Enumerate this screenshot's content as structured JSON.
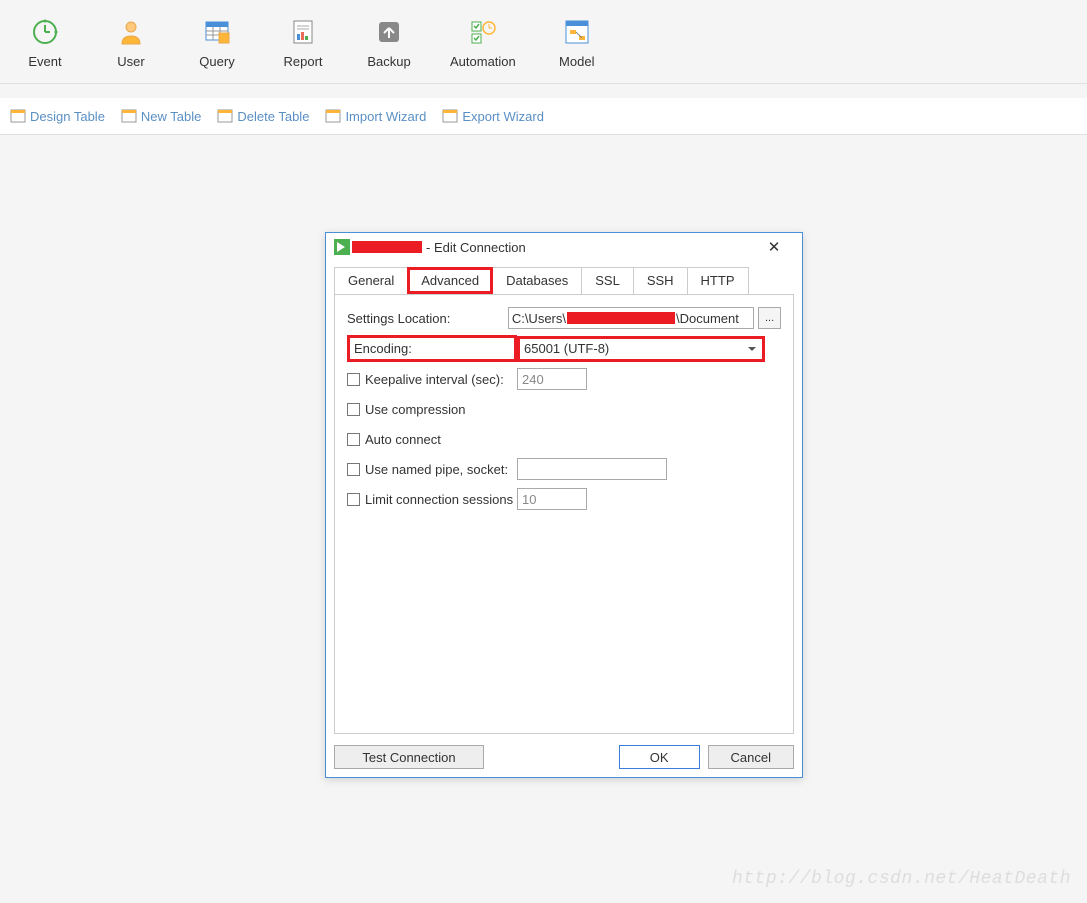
{
  "toolbar": {
    "items": [
      {
        "label": "Event"
      },
      {
        "label": "User"
      },
      {
        "label": "Query"
      },
      {
        "label": "Report"
      },
      {
        "label": "Backup"
      },
      {
        "label": "Automation"
      },
      {
        "label": "Model"
      }
    ]
  },
  "subtoolbar": {
    "items": [
      {
        "label": "Design Table"
      },
      {
        "label": "New Table"
      },
      {
        "label": "Delete Table"
      },
      {
        "label": "Import Wizard"
      },
      {
        "label": "Export Wizard"
      }
    ]
  },
  "dialog": {
    "title_suffix": "- Edit Connection",
    "tabs": [
      {
        "label": "General"
      },
      {
        "label": "Advanced"
      },
      {
        "label": "Databases"
      },
      {
        "label": "SSL"
      },
      {
        "label": "SSH"
      },
      {
        "label": "HTTP"
      }
    ],
    "active_tab_index": 1,
    "form": {
      "settings_location_label": "Settings Location:",
      "settings_location_prefix": "C:\\Users\\",
      "settings_location_suffix": "\\Document",
      "browse_label": "...",
      "encoding_label": "Encoding:",
      "encoding_value": "65001 (UTF-8)",
      "keepalive_label": "Keepalive interval (sec):",
      "keepalive_value": "240",
      "use_compression_label": "Use compression",
      "auto_connect_label": "Auto connect",
      "named_pipe_label": "Use named pipe, socket:",
      "named_pipe_value": "",
      "limit_sessions_label": "Limit connection sessions",
      "limit_sessions_value": "10"
    },
    "buttons": {
      "test": "Test Connection",
      "ok": "OK",
      "cancel": "Cancel"
    }
  },
  "watermark": "http://blog.csdn.net/HeatDeath"
}
